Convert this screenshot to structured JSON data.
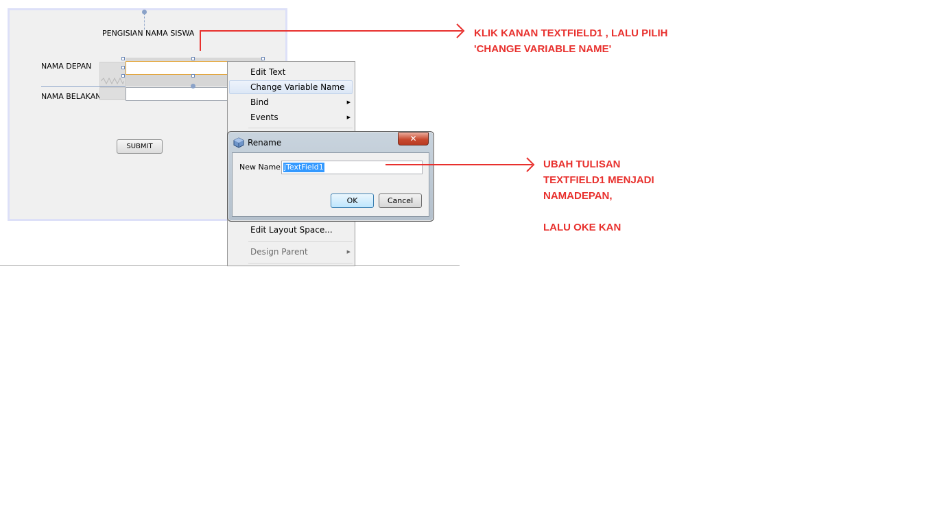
{
  "design_form": {
    "title_label": "PENGISIAN NAMA SISWA",
    "label_first_name": "NAMA DEPAN",
    "label_last_name": "NAMA BELAKANG",
    "submit_button": "SUBMIT"
  },
  "context_menu": {
    "items": [
      {
        "label": "Edit Text",
        "has_submenu": false
      },
      {
        "label": "Change Variable Name ...",
        "has_submenu": false,
        "highlighted": true
      },
      {
        "label": "Bind",
        "has_submenu": true
      },
      {
        "label": "Events",
        "has_submenu": true
      }
    ],
    "lower_items": [
      {
        "label": "Edit Layout Space...",
        "has_submenu": false
      },
      {
        "label": "Design Parent",
        "has_submenu": true,
        "disabled": true
      }
    ]
  },
  "rename_dialog": {
    "title": "Rename",
    "close_glyph": "✕",
    "new_name_label": "New Name:",
    "new_name_value": "jTextField1",
    "ok_label": "OK",
    "cancel_label": "Cancel"
  },
  "annotations": {
    "note_1": [
      "KLIK KANAN TEXTFIELD1 , LALU PILIH",
      "'CHANGE VARIABLE NAME'"
    ],
    "note_2": [
      "UBAH TULISAN",
      "TEXTFIELD1 MENJADI",
      "NAMADEPAN,",
      "",
      "LALU OKE KAN"
    ],
    "color": "#e8302d"
  },
  "icons": {
    "dialog_icon": "netbeans-cube-icon",
    "submenu_arrow": "triangle-right-icon"
  }
}
